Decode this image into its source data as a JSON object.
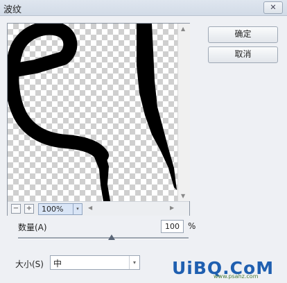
{
  "window": {
    "title": "波纹",
    "close_glyph": "✕"
  },
  "buttons": {
    "ok": "确定",
    "cancel": "取消"
  },
  "zoom": {
    "minus": "−",
    "plus": "+",
    "value": "100%",
    "dropdown_glyph": "▾"
  },
  "amount": {
    "label": "数量(A)",
    "value": "100",
    "unit": "%",
    "level_percent": 100
  },
  "size": {
    "label": "大小(S)",
    "value": "中",
    "dropdown_glyph": "▾"
  },
  "watermark": {
    "text": "UiBQ.CoM",
    "sub": "www.psahz.com"
  },
  "colors": {
    "ink": "#000000",
    "checker": "#cfcfcf",
    "watermark": "#1f5fb0"
  },
  "icons": [
    "close-icon",
    "zoom-out-icon",
    "zoom-in-icon",
    "chevron-down-icon",
    "scroll-arrow-icon"
  ]
}
